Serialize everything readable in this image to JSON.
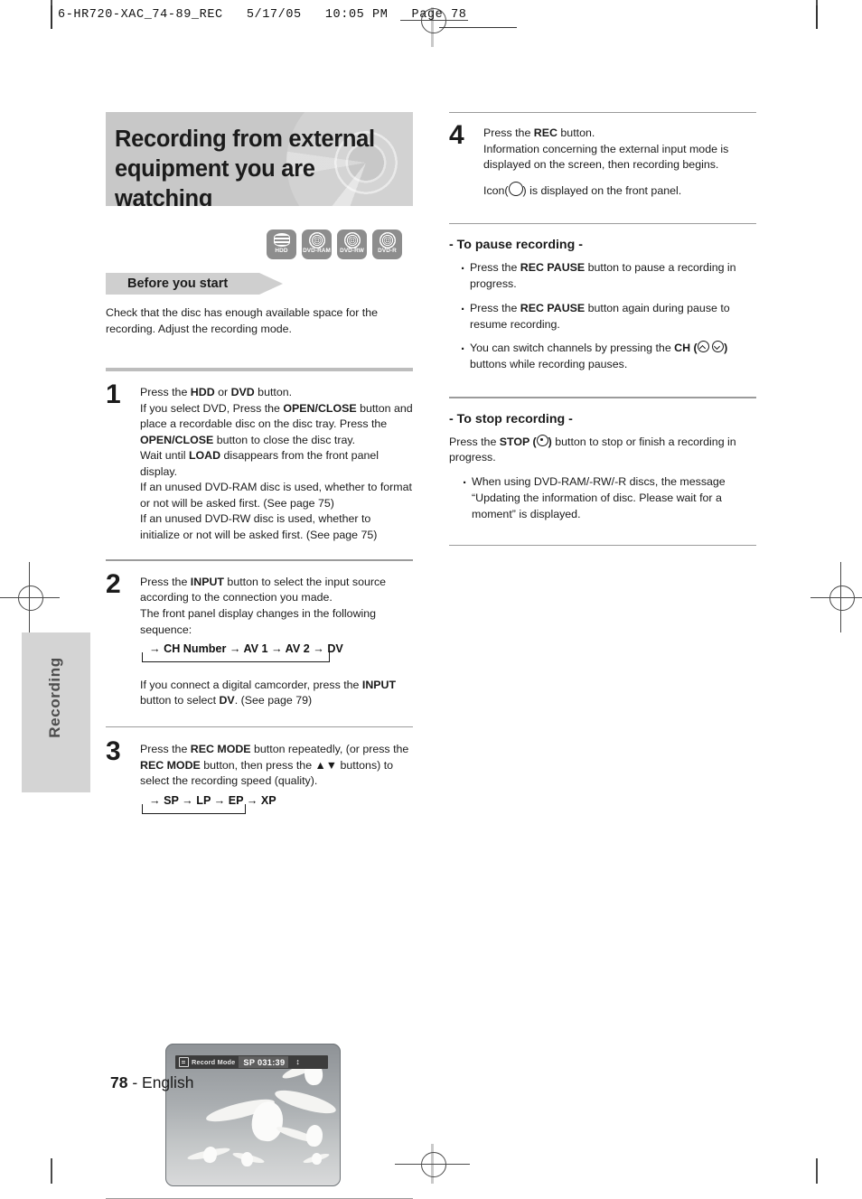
{
  "print_header": {
    "text": "6-HR720-XAC_74-89_REC   5/17/05   10:05 PM   Page 78"
  },
  "side_tab": {
    "label": "Recording"
  },
  "title": {
    "line1": "Recording from external",
    "line2": "equipment you are watching"
  },
  "disc_icons": [
    {
      "name": "hdd-icon",
      "label": "HDD"
    },
    {
      "name": "dvd-ram-icon",
      "label": "DVD-RAM"
    },
    {
      "name": "dvd-rw-icon",
      "label": "DVD-RW"
    },
    {
      "name": "dvd-r-icon",
      "label": "DVD-R"
    }
  ],
  "before_start": {
    "heading": "Before you start",
    "text": "Check that the disc has enough available space for the recording. Adjust the recording mode."
  },
  "steps": [
    {
      "number": "1",
      "lines": [
        "Press the <b>HDD</b> or <b>DVD</b> button.",
        "If you select DVD, Press the <b>OPEN/CLOSE</b> button and place a recordable disc on the disc tray. Press the <b>OPEN/CLOSE</b> button to close the disc tray.",
        "Wait until <b>LOAD</b> disappears from the front panel display.",
        "If an unused DVD-RAM disc is used, whether to format or not will be asked first. (See page 75)",
        "If an unused DVD-RW disc is used, whether to initialize or not will be asked first. (See page 75)"
      ]
    },
    {
      "number": "2",
      "lines": [
        "Press the <b>INPUT</b> button to select the input source according to the connection you made.",
        "The front panel display changes in the following sequence:"
      ],
      "sequence": "→ CH Number → AV 1 → AV 2 → DV",
      "after": "If you connect a digital camcorder, press the <b>INPUT</b> button to select <b>DV</b>. (See page 79)"
    },
    {
      "number": "3",
      "lines": [
        "Press the <b>REC MODE</b> button repeatedly, (or press the <b>REC MODE</b> button, then press the ▲▼ buttons) to select the recording speed (quality)."
      ],
      "sequence": "→ SP → LP → EP → XP"
    },
    {
      "number": "4",
      "lines": [
        "Press the <b>REC</b> button.",
        "Information concerning the external input mode is displayed on the screen, then recording begins."
      ],
      "icon_line_prefix": "Icon(",
      "icon_line_suffix": ") is displayed on the front panel."
    }
  ],
  "photo_osd": {
    "label": "Record Mode",
    "value": "SP 031:39",
    "arrow": "↕"
  },
  "pause_section": {
    "heading": "- To pause recording -",
    "bullets": [
      "Press the <b>REC PAUSE</b> button to pause a recording in progress.",
      "Press the <b>REC PAUSE</b> button again during pause to resume recording.",
      "You can switch channels by pressing the <b>CH (</b>__CH_ICONS__<b>)</b> buttons while recording pauses."
    ]
  },
  "stop_section": {
    "heading": "- To stop recording -",
    "paragraph_prefix": "Press the <b>STOP (</b>",
    "paragraph_suffix": "<b>)</b> button to stop or finish a recording in progress.",
    "bullets": [
      "When using DVD-RAM/-RW/-R discs, the message “Updating the information of disc. Please wait for a moment” is displayed."
    ]
  },
  "footer": {
    "page": "78",
    "separator": " - ",
    "language": "English"
  }
}
